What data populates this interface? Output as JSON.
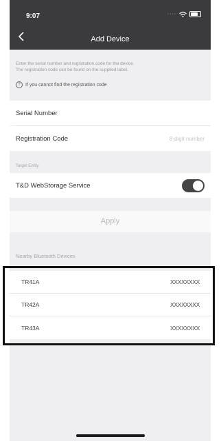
{
  "status_bar": {
    "time": "9:07",
    "signal": "····"
  },
  "nav": {
    "title": "Add Device"
  },
  "note": {
    "line1": "Enter the serial number and registration code for the device.",
    "line2": "The registration code can be found on the supplied label."
  },
  "help": {
    "label": "If you cannot find the registration code"
  },
  "form": {
    "serial_label": "Serial Number",
    "registration_label": "Registration Code",
    "registration_placeholder": "8-digit number"
  },
  "target": {
    "section_label": "Target Entity",
    "service_label": "T&D WebStorage Service",
    "toggle_on": true
  },
  "apply_label": "Apply",
  "bluetooth": {
    "section_label": "Nearby Bluetooth Devices",
    "devices": [
      {
        "name": "TR41A",
        "serial": "XXXXXXXX"
      },
      {
        "name": "TR42A",
        "serial": "XXXXXXXX"
      },
      {
        "name": "TR43A",
        "serial": "XXXXXXXX"
      }
    ]
  },
  "colors": {
    "header_bg": "#3b3b3d",
    "page_bg": "#efeff1",
    "toggle_on": "#454547",
    "highlight": "#111111"
  }
}
